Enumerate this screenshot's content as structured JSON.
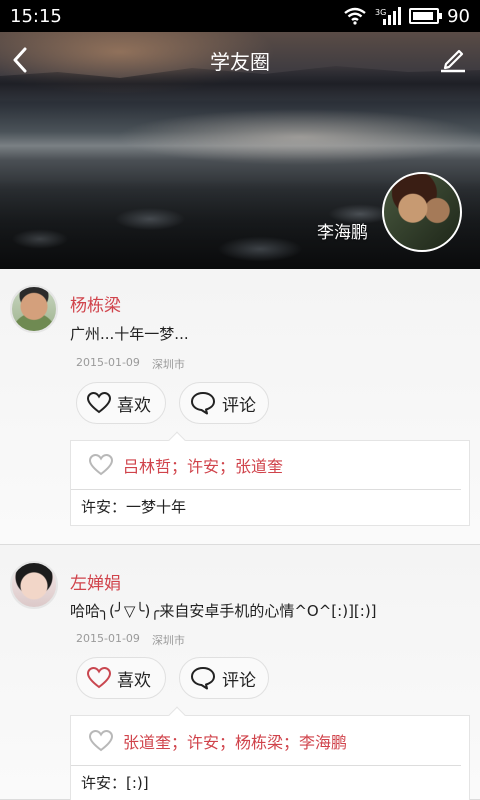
{
  "status_bar": {
    "time": "15:15",
    "network": "3G",
    "battery_level": "90",
    "battery_fraction": 0.9
  },
  "header": {
    "title": "学友圈",
    "user_name": "李海鹏"
  },
  "posts": [
    {
      "author": "杨栋梁",
      "text": "广州...十年一梦...",
      "date": "2015-01-09",
      "location": "深圳市",
      "like_label": "喜欢",
      "comment_label": "评论",
      "likers": "吕林哲；许安；张道奎",
      "comments": [
        "许安：一梦十年"
      ]
    },
    {
      "author": "左婵娟",
      "text": "哈哈╮(╯▽╰)╭来自安卓手机的心情^O^[:)][:)]",
      "date": "2015-01-09",
      "location": "深圳市",
      "like_label": "喜欢",
      "comment_label": "评论",
      "likers": "张道奎；许安；杨栋梁；李海鹏",
      "comments": [
        "许安：[:)]"
      ]
    }
  ],
  "colors": {
    "accent": "#d0434b",
    "status_bar": "#000000"
  },
  "icons": {
    "back": "chevron-left-icon",
    "edit": "pencil-icon",
    "like": "heart-icon",
    "comment": "speech-bubble-icon"
  }
}
